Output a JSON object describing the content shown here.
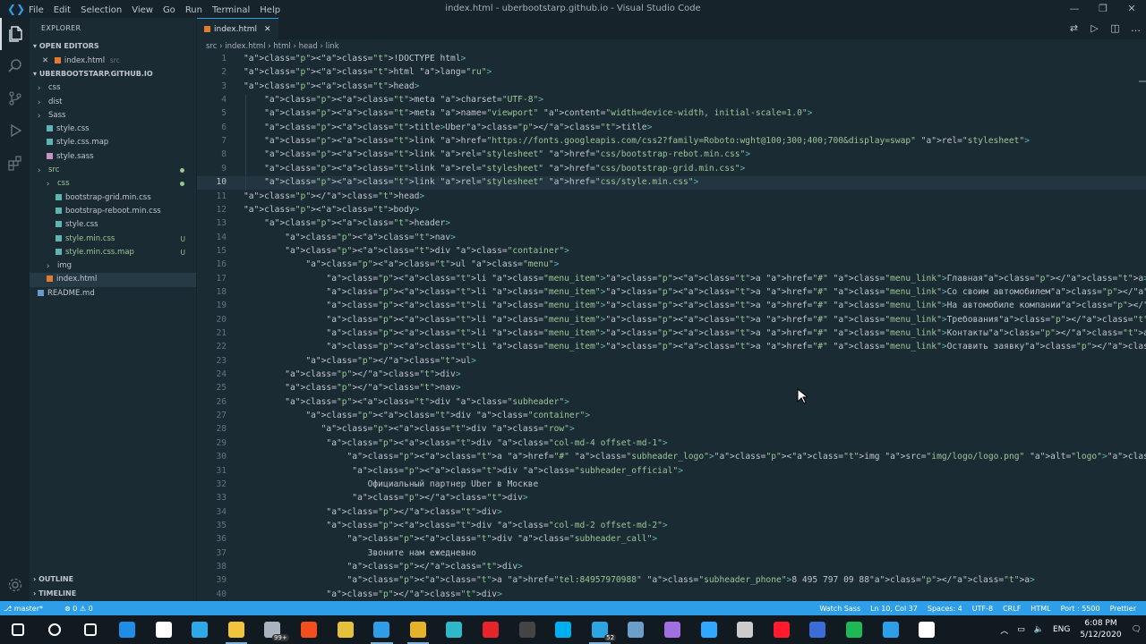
{
  "window": {
    "title": "index.html - uberbootstarp.github.io - Visual Studio Code",
    "menu": [
      "File",
      "Edit",
      "Selection",
      "View",
      "Go",
      "Run",
      "Terminal",
      "Help"
    ],
    "controls": [
      "minimize-icon",
      "restore-icon",
      "close-icon"
    ]
  },
  "activity_bar": {
    "items": [
      {
        "name": "explorer-icon",
        "active": true
      },
      {
        "name": "search-icon",
        "active": false
      },
      {
        "name": "source-control-icon",
        "active": false
      },
      {
        "name": "run-debug-icon",
        "active": false
      },
      {
        "name": "extensions-icon",
        "active": false
      }
    ],
    "bottom": "gear-icon"
  },
  "sidebar": {
    "title": "EXPLORER",
    "open_editors": {
      "label": "OPEN EDITORS",
      "items": [
        {
          "name": "index.html",
          "dir": "src"
        }
      ]
    },
    "workspace": {
      "label": "UBERBOOTSTARP.GITHUB.IO",
      "items": [
        {
          "label": "css",
          "type": "folder",
          "indent": 0
        },
        {
          "label": "dist",
          "type": "folder",
          "indent": 0
        },
        {
          "label": "Sass",
          "type": "folder",
          "indent": 0
        },
        {
          "label": "style.css",
          "type": "css",
          "indent": 1
        },
        {
          "label": "style.css.map",
          "type": "map",
          "indent": 1
        },
        {
          "label": "style.sass",
          "type": "sass",
          "indent": 1
        },
        {
          "label": "src",
          "type": "folder",
          "indent": 0,
          "color": "#99c794",
          "dot": true
        },
        {
          "label": "css",
          "type": "folder",
          "indent": 1,
          "color": "#99c794",
          "dot": true
        },
        {
          "label": "bootstrap-grid.min.css",
          "type": "css",
          "indent": 2
        },
        {
          "label": "bootstrap-reboot.min.css",
          "type": "css",
          "indent": 2
        },
        {
          "label": "style.css",
          "type": "css",
          "indent": 2
        },
        {
          "label": "style.min.css",
          "type": "css",
          "indent": 2,
          "color": "#99c794",
          "badge": "U"
        },
        {
          "label": "style.min.css.map",
          "type": "map",
          "indent": 2,
          "color": "#99c794",
          "badge": "U"
        },
        {
          "label": "img",
          "type": "folder",
          "indent": 1
        },
        {
          "label": "index.html",
          "type": "html",
          "indent": 1,
          "selected": true
        },
        {
          "label": "README.md",
          "type": "md",
          "indent": 0
        }
      ]
    },
    "outline": "OUTLINE",
    "timeline": "TIMELINE"
  },
  "editor": {
    "tab": "index.html",
    "breadcrumbs": [
      "src",
      "index.html",
      "html",
      "head",
      "link"
    ],
    "current_line": 10,
    "lines": [
      "<!DOCTYPE html>",
      "<html lang=\"ru\">",
      "<head>",
      "    <meta charset=\"UTF-8\">",
      "    <meta name=\"viewport\" content=\"width=device-width, initial-scale=1.0\">",
      "    <title>Uber</title>",
      "    <link href=\"https://fonts.googleapis.com/css2?family=Roboto:wght@100;300;400;700&display=swap\" rel=\"stylesheet\">",
      "    <link rel=\"stylesheet\" href=\"css/bootstrap-rebot.min.css\">",
      "    <link rel=\"stylesheet\" href=\"css/bootstrap-grid.min.css\">",
      "    <link rel=\"stylesheet\" href=\"css/style.min.css\">",
      "</head>",
      "<body>",
      "    <header>",
      "        <nav>",
      "        <div class=\"container\">",
      "            <ul class=\"menu\">",
      "                <li class=\"menu_item\"><a href=\"#\" class=\"menu_link\">Главная</a></li>",
      "                <li class=\"menu_item\"><a href=\"#\" class=\"menu_link\">Со своим автомобилем</a></li>",
      "                <li class=\"menu_item\"><a href=\"#\" class=\"menu_link\">На автомобиле компании</a></li>",
      "                <li class=\"menu_item\"><a href=\"#\" class=\"menu_link\">Требования</a></li>",
      "                <li class=\"menu_item\"><a href=\"#\" class=\"menu_link\">Контакты</a></li>",
      "                <li class=\"menu_item\"><a href=\"#\" class=\"menu_link\">Оставить заявку</a></li>",
      "            </ul>",
      "        </div>",
      "        </nav>",
      "        <div class=\"subheader\">",
      "            <div class=\"container\">",
      "               <div class=\"row\">",
      "                <div class=\"col-md-4 offset-md-1\">",
      "                    <a href=\"#\" class=\"subheader_logo\"><img src=\"img/logo/logo.png\" alt=\"logo\"></a>",
      "                     <div class=\"subheader_official\">",
      "                        Официальный партнер Uber в Москве",
      "                     </div>",
      "                </div>",
      "                <div class=\"col-md-2 offset-md-2\">",
      "                    <div class=\"subheader_call\">",
      "                        Звоните нам ежедневно",
      "                    </div>",
      "                    <a href=\"tel:84957970988\" class=\"subheader_phone\">8 495 797 09 88</a>",
      "                </div>"
    ]
  },
  "statusbar": {
    "branch": "master*",
    "problems": "⊗ 0 ⚠ 0",
    "right": [
      "Watch Sass",
      "Ln 10, Col 37",
      "Spaces: 4",
      "UTF-8",
      "CRLF",
      "HTML",
      "Port : 5500",
      "Prettier"
    ]
  },
  "taskbar": {
    "apps": [
      {
        "name": "windows-start-icon",
        "color": "#ffffff"
      },
      {
        "name": "search-icon",
        "color": "#ffffff"
      },
      {
        "name": "task-view-icon",
        "color": "#ffffff"
      },
      {
        "name": "edge-icon",
        "color": "#1f8ce6"
      },
      {
        "name": "store-icon",
        "color": "#ffffff"
      },
      {
        "name": "powerapp-icon",
        "color": "#2fa8e8"
      },
      {
        "name": "file-explorer-icon",
        "color": "#f2c33c",
        "running": true
      },
      {
        "name": "mail-icon",
        "color": "#aab4c0",
        "badge": "99+"
      },
      {
        "name": "figma-icon",
        "color": "#f24e1e"
      },
      {
        "name": "git-icon",
        "color": "#e6c03a"
      },
      {
        "name": "vscode-icon",
        "color": "#2f9ee8",
        "running": true
      },
      {
        "name": "chrome-icon",
        "color": "#e5b22a",
        "running": true
      },
      {
        "name": "app-icon",
        "color": "#2fb8c8"
      },
      {
        "name": "acrobat-icon",
        "color": "#e5252a"
      },
      {
        "name": "terminal-icon",
        "color": "#444444"
      },
      {
        "name": "skype-icon",
        "color": "#00aff0"
      },
      {
        "name": "telegram-icon",
        "color": "#2ca5e0",
        "badge": "52",
        "running": true
      },
      {
        "name": "keepass-icon",
        "color": "#6aa0c8"
      },
      {
        "name": "browser-icon",
        "color": "#a070e0"
      },
      {
        "name": "photoshop-icon",
        "color": "#31a8ff"
      },
      {
        "name": "obs-icon",
        "color": "#cccccc"
      },
      {
        "name": "opera-icon",
        "color": "#ff1b2d"
      },
      {
        "name": "notes-icon",
        "color": "#3c6cd8"
      },
      {
        "name": "spotify-icon",
        "color": "#1db954"
      },
      {
        "name": "help-icon",
        "color": "#2f9ee8"
      },
      {
        "name": "people-icon",
        "color": "#ffffff"
      }
    ],
    "tray": {
      "lang": "ENG",
      "time": "6:08 PM",
      "date": "5/12/2020"
    }
  }
}
